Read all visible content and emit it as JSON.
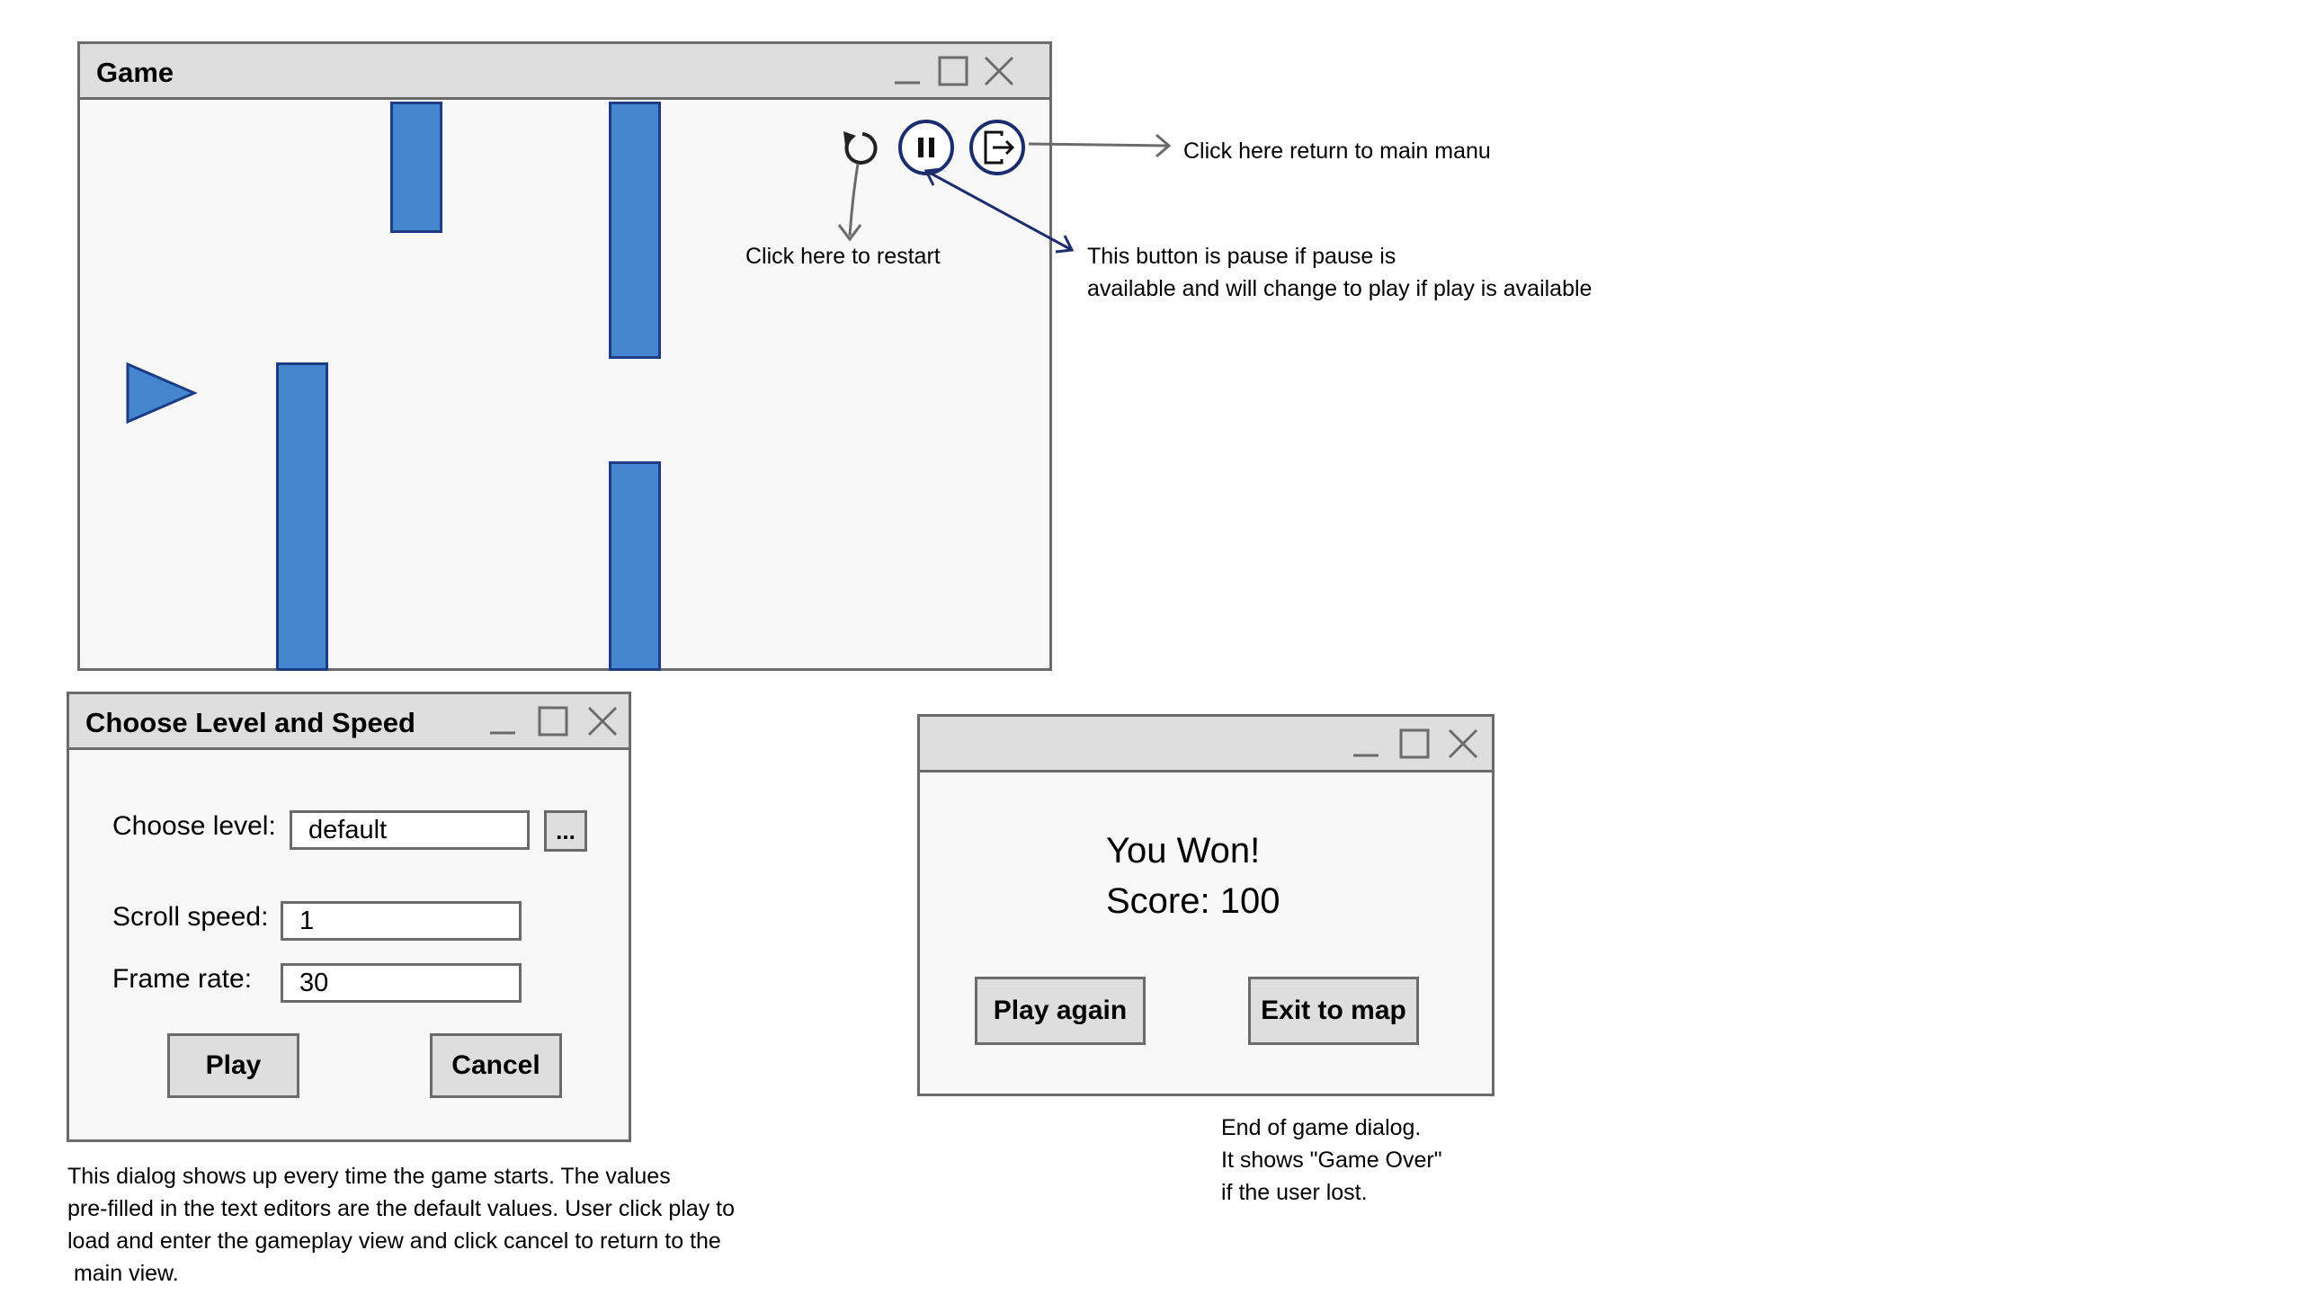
{
  "game_window": {
    "title": "Game",
    "controls": {
      "minimize_icon": "minimize-icon",
      "maximize_icon": "maximize-icon",
      "close_icon": "close-icon"
    },
    "buttons": [
      {
        "name": "restart-button",
        "icon": "restart-icon"
      },
      {
        "name": "pause-button",
        "icon": "pause-icon"
      },
      {
        "name": "exit-to-menu-button",
        "icon": "exit-icon"
      }
    ],
    "colors": {
      "obstacle": "#4487d0",
      "obstacle_border": "#1c3c84",
      "annotation_arrow": "#1c2d6e"
    }
  },
  "annotations": {
    "restart": "Click here to restart",
    "pause_line1": "This button is pause if pause is",
    "pause_line2": "available and will change to play if play is available",
    "main_menu": "Click here return to main manu",
    "level_dialog_lines": [
      "This dialog shows up every time the game starts. The values",
      "pre-filled in the text editors are the default values. User click play to",
      "load and enter the gameplay view and click cancel to return to the",
      " main view."
    ],
    "end_dialog_lines": [
      "End of game dialog.",
      "It shows \"Game Over\"",
      "if the user lost."
    ]
  },
  "level_dialog": {
    "title": "Choose Level and Speed",
    "level_label": "Choose level:",
    "level_value": "default",
    "browse_label": "...",
    "speed_label": "Scroll speed:",
    "speed_value": "1",
    "frame_label": "Frame rate:",
    "frame_value": "30",
    "play_label": "Play",
    "cancel_label": "Cancel"
  },
  "end_dialog": {
    "title": "",
    "message": "You Won!",
    "score_text": "Score: 100",
    "play_again_label": "Play again",
    "exit_label": "Exit to map"
  }
}
